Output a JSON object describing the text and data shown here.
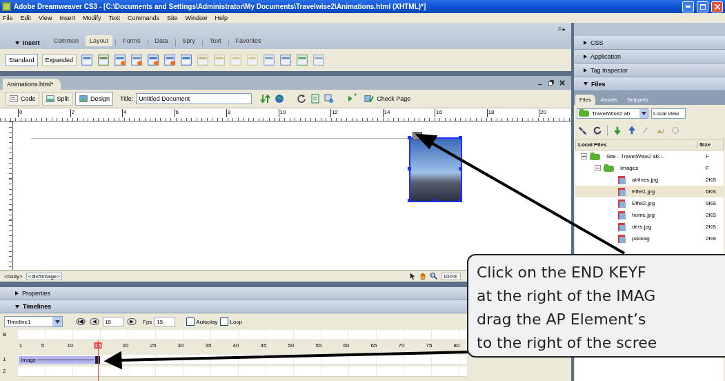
{
  "window": {
    "title": "Adobe Dreamweaver CS3 - [C:\\Documents and Settings\\Administrator\\My Documents\\Travelwise2\\Animations.html (XHTML)*]"
  },
  "menu": [
    "File",
    "Edit",
    "View",
    "Insert",
    "Modify",
    "Text",
    "Commands",
    "Site",
    "Window",
    "Help"
  ],
  "insert_bar": {
    "label": "Insert",
    "expanded": true,
    "tabs": [
      {
        "label": "Common",
        "selected": false
      },
      {
        "label": "Layout",
        "selected": true
      },
      {
        "label": "Forms",
        "selected": false
      },
      {
        "label": "Data",
        "selected": false
      },
      {
        "label": "Spry",
        "selected": false
      },
      {
        "label": "Text",
        "selected": false
      },
      {
        "label": "Favorites",
        "selected": false
      }
    ],
    "modes": [
      {
        "label": "Standard",
        "selected": true
      },
      {
        "label": "Expanded",
        "selected": false
      }
    ]
  },
  "document": {
    "tab": "Animations.html*",
    "views": [
      {
        "label": "Code",
        "selected": false
      },
      {
        "label": "Split",
        "selected": false
      },
      {
        "label": "Design",
        "selected": true
      }
    ],
    "title_label": "Title:",
    "title_value": "Untitled Document",
    "check_page": "Check Page",
    "ruler": [
      "0",
      "2",
      "4",
      "6",
      "8",
      "10",
      "12",
      "14",
      "16",
      "18",
      "20"
    ],
    "tag_selector": [
      "<body>",
      "<div#Image>"
    ],
    "zoom": "100%"
  },
  "properties": {
    "label": "Properties",
    "expanded": false
  },
  "timelines": {
    "label": "Timelines",
    "expanded": true,
    "timeline": "Timeline1",
    "frame": "15",
    "fps_label": "Fps",
    "fps": "15",
    "autoplay": {
      "label": "Autoplay",
      "checked": false
    },
    "loop": {
      "label": "Loop",
      "checked": false
    },
    "behaviors_row": "B",
    "frames": [
      {
        "label": "1",
        "selected": false
      },
      {
        "label": "5",
        "selected": false
      },
      {
        "label": "10",
        "selected": false
      },
      {
        "label": "15",
        "selected": true
      },
      {
        "label": "20",
        "selected": false
      },
      {
        "label": "25",
        "selected": false
      },
      {
        "label": "30",
        "selected": false
      },
      {
        "label": "35",
        "selected": false
      },
      {
        "label": "40",
        "selected": false
      },
      {
        "label": "45",
        "selected": false
      },
      {
        "label": "50",
        "selected": false
      },
      {
        "label": "55",
        "selected": false
      },
      {
        "label": "60",
        "selected": false
      },
      {
        "label": "65",
        "selected": false
      },
      {
        "label": "70",
        "selected": false
      },
      {
        "label": "75",
        "selected": false
      },
      {
        "label": "80",
        "selected": false
      }
    ],
    "channels": [
      {
        "number": "1",
        "sprite": "Image"
      },
      {
        "number": "2"
      }
    ]
  },
  "side_panels": [
    {
      "label": "CSS",
      "expanded": false
    },
    {
      "label": "Application",
      "expanded": false
    },
    {
      "label": "Tag Inspector",
      "expanded": false
    },
    {
      "label": "Files",
      "expanded": true
    }
  ],
  "files": {
    "tabs": [
      {
        "label": "Files",
        "selected": true
      },
      {
        "label": "Assets",
        "selected": false
      },
      {
        "label": "Snippets",
        "selected": false
      }
    ],
    "site": "TravelWise2 ab",
    "view": "Local view",
    "columns": [
      "Local Files",
      "Size"
    ],
    "tree": [
      {
        "name": "Site - TravelWise2 ab...",
        "size": "F",
        "expanded": true,
        "children": [
          {
            "name": "Images",
            "size": "F",
            "expanded": true,
            "children": [
              {
                "name": "airlines.jpg",
                "size": "2KB",
                "selected": false
              },
              {
                "name": "Effel1.jpg",
                "size": "6KB",
                "selected": true
              },
              {
                "name": "Effel2.jpg",
                "size": "9KB",
                "selected": false
              },
              {
                "name": "home.jpg",
                "size": "2KB",
                "selected": false
              },
              {
                "name": "ders.jpg",
                "size": "2KB",
                "selected": false
              },
              {
                "name": "packag",
                "size": "2KB",
                "selected": false
              }
            ]
          }
        ]
      }
    ]
  },
  "callout": {
    "lines": [
      "Click on the END KEYF",
      "at the right of the IMAG",
      "drag the AP Element’s",
      "to the right of the scree"
    ]
  }
}
